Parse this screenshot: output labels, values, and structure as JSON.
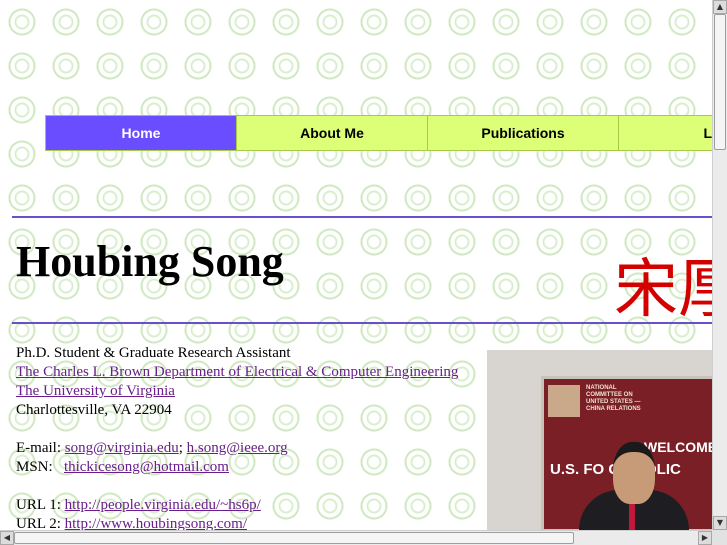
{
  "nav": {
    "items": [
      {
        "label": "Home"
      },
      {
        "label": "About Me"
      },
      {
        "label": "Publications"
      },
      {
        "label": "Lin"
      }
    ]
  },
  "header": {
    "name": "Houbing Song",
    "chinese_name": "宋厚"
  },
  "info": {
    "line1": "Ph.D. Student & Graduate Research Assistant",
    "department_link": "The Charles L. Brown Department of Electrical & Computer Engineering",
    "university_link": "The University of Virginia",
    "address": "Charlottesville, VA 22904",
    "email_label": "E-mail:",
    "email1": "song@virginia.edu",
    "email_sep": ";",
    "email2": "h.song@ieee.org",
    "msn_label": "MSN:",
    "msn": "thickicesong@hotmail.com",
    "url1_label": "URL 1:",
    "url1": "http://people.virginia.edu/~hs6p/",
    "url2_label": "URL 2:",
    "url2": "http://www.houbingsong.com/"
  },
  "photo": {
    "banner_small": "NATIONAL COMMITTEE ON UNITED STATES — CHINA RELATIONS",
    "banner_welcome": "WELCOME",
    "banner_policy": "U.S. FO  GN POLIC"
  },
  "colors": {
    "nav_active": "#6a4dff",
    "nav_bg": "#ddff77",
    "rule": "#6650cc",
    "link": "#6a1e8c",
    "chinese": "#d40000"
  }
}
